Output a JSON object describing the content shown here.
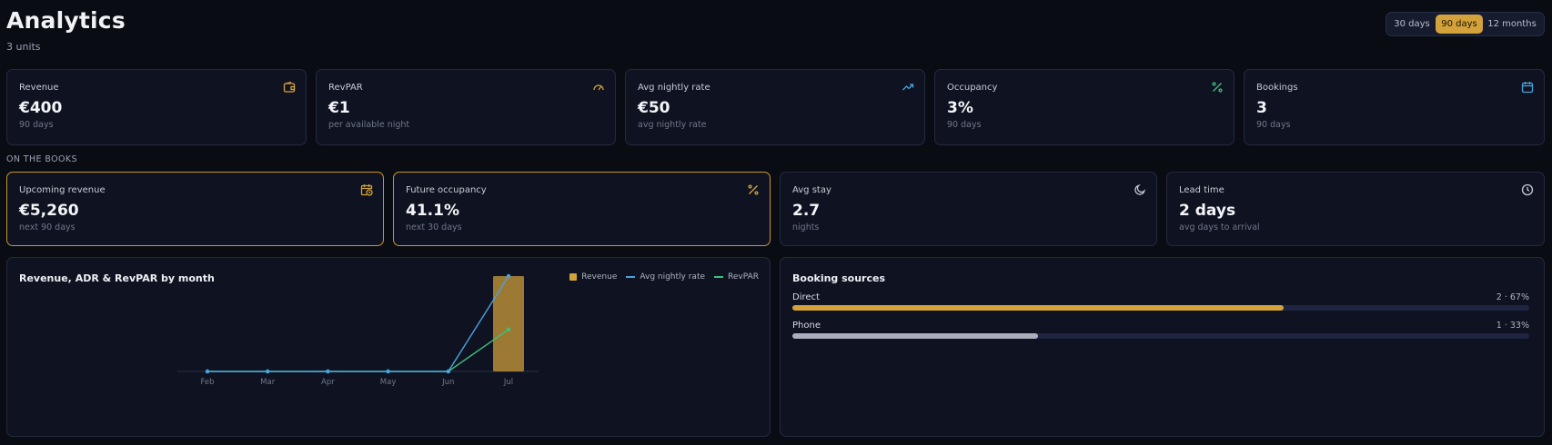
{
  "header": {
    "title": "Analytics",
    "subtitle": "3 units"
  },
  "range": {
    "options": [
      "30 days",
      "90 days",
      "12 months"
    ],
    "selected": "90 days"
  },
  "kpis": [
    {
      "label": "Revenue",
      "value": "€400",
      "sub": "90 days",
      "icon": "wallet-icon",
      "color": "#d3a23b"
    },
    {
      "label": "RevPAR",
      "value": "€1",
      "sub": "per available night",
      "icon": "gauge-icon",
      "color": "#d3a23b"
    },
    {
      "label": "Avg nightly rate",
      "value": "€50",
      "sub": "avg nightly rate",
      "icon": "trending-up-icon",
      "color": "#4aa3df"
    },
    {
      "label": "Occupancy",
      "value": "3%",
      "sub": "90 days",
      "icon": "percent-icon",
      "color": "#3fbf7f"
    },
    {
      "label": "Bookings",
      "value": "3",
      "sub": "90 days",
      "icon": "calendar-icon",
      "color": "#4aa3df"
    }
  ],
  "on_the_books": {
    "label": "ON THE BOOKS",
    "cards": [
      {
        "label": "Upcoming revenue",
        "value": "€5,260",
        "sub": "next 90 days",
        "icon": "calendar-clock-icon",
        "color": "#d3a23b"
      },
      {
        "label": "Future occupancy",
        "value": "41.1%",
        "sub": "next 30 days",
        "icon": "percent-icon",
        "color": "#d3a23b"
      },
      {
        "label": "Avg stay",
        "value": "2.7",
        "sub": "nights",
        "icon": "moon-icon",
        "color": "#c7ccd8"
      },
      {
        "label": "Lead time",
        "value": "2 days",
        "sub": "avg days to arrival",
        "icon": "clock-icon",
        "color": "#c7ccd8"
      }
    ]
  },
  "chart": {
    "title": "Revenue, ADR & RevPAR by month",
    "legend": [
      "Revenue",
      "Avg nightly rate",
      "RevPAR"
    ]
  },
  "chart_data": {
    "type": "bar",
    "categories": [
      "Feb",
      "Mar",
      "Apr",
      "May",
      "Jun",
      "Jul"
    ],
    "series": [
      {
        "name": "Revenue",
        "type": "bar",
        "values": [
          0,
          0,
          0,
          0,
          0,
          400
        ],
        "color": "#d3a23b"
      },
      {
        "name": "Avg nightly rate",
        "type": "line",
        "values": [
          0,
          0,
          0,
          0,
          0,
          50
        ],
        "color": "#4aa3df"
      },
      {
        "name": "RevPAR",
        "type": "line",
        "values": [
          0,
          0,
          0,
          0,
          0,
          22
        ],
        "color": "#3fbf7f"
      }
    ],
    "title": "Revenue, ADR & RevPAR by month",
    "legend_position": "top-right",
    "grid": false
  },
  "sources": {
    "title": "Booking sources",
    "items": [
      {
        "name": "Direct",
        "stat": "2 · 67%",
        "fraction": 0.667,
        "color": "#d3a23b"
      },
      {
        "name": "Phone",
        "stat": "1 · 33%",
        "fraction": 0.333,
        "color": "#a9afbd"
      }
    ]
  }
}
